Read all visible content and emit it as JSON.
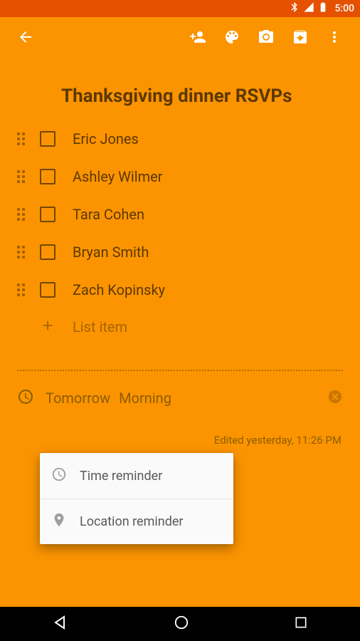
{
  "status": {
    "time": "5:00"
  },
  "note": {
    "title": "Thanksgiving dinner RSVPs",
    "items": [
      {
        "label": "Eric Jones"
      },
      {
        "label": "Ashley Wilmer"
      },
      {
        "label": "Tara Cohen"
      },
      {
        "label": "Bryan Smith"
      },
      {
        "label": "Zach Kopinsky"
      }
    ],
    "add_placeholder": "List item"
  },
  "reminder": {
    "day": "Tomorrow",
    "time": "Morning"
  },
  "edited": "Edited yesterday, 11:26 PM",
  "popup": {
    "time_reminder": "Time reminder",
    "location_reminder": "Location reminder"
  }
}
